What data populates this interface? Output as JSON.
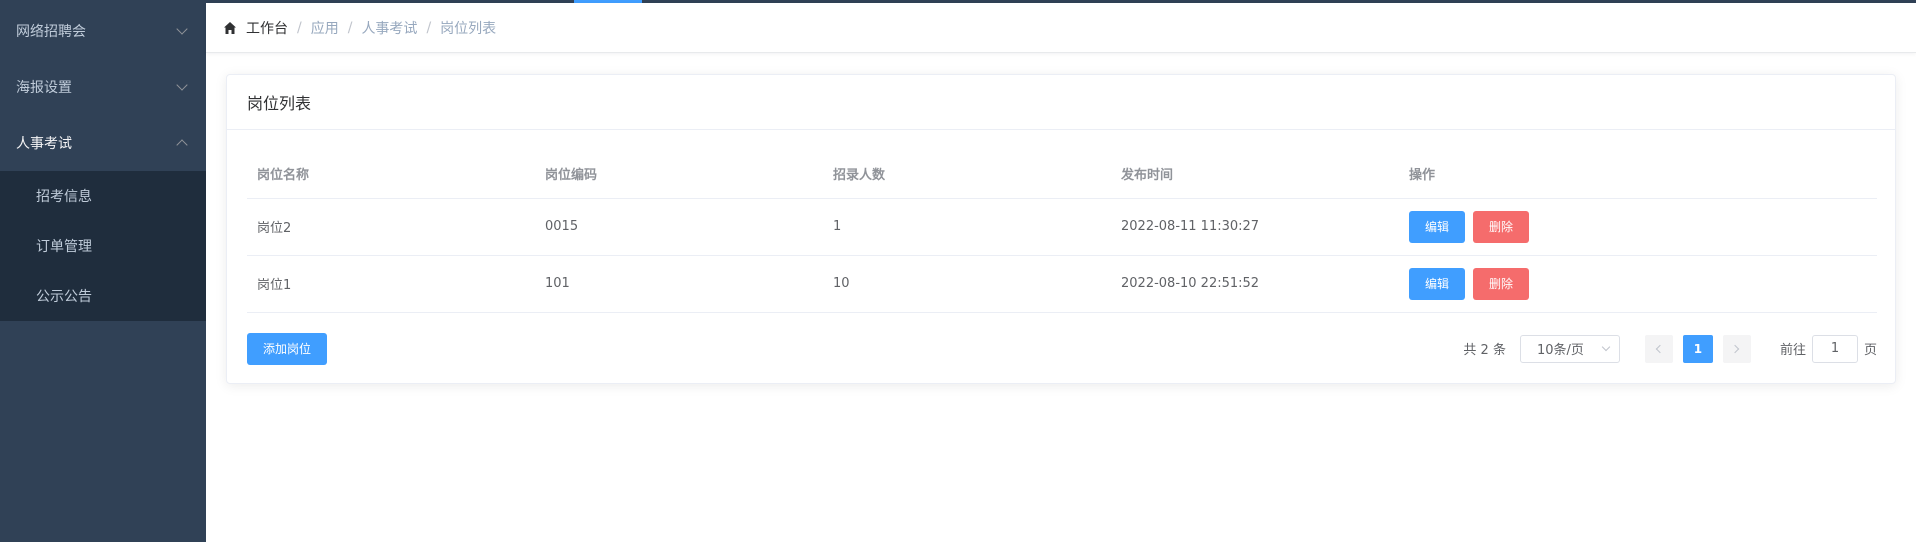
{
  "sidebar": {
    "items": [
      {
        "label": "网络招聘会"
      },
      {
        "label": "海报设置"
      },
      {
        "label": "人事考试"
      }
    ],
    "submenu": [
      {
        "label": "招考信息"
      },
      {
        "label": "订单管理"
      },
      {
        "label": "公示公告"
      }
    ]
  },
  "breadcrumb": {
    "items": [
      "工作台",
      "应用",
      "人事考试",
      "岗位列表"
    ],
    "separator": "/"
  },
  "card": {
    "title": "岗位列表"
  },
  "table": {
    "headers": [
      "岗位名称",
      "岗位编码",
      "招录人数",
      "发布时间",
      "操作"
    ],
    "rows": [
      {
        "name": "岗位2",
        "code": "0015",
        "count": "1",
        "time": "2022-08-11 11:30:27"
      },
      {
        "name": "岗位1",
        "code": "101",
        "count": "10",
        "time": "2022-08-10 22:51:52"
      }
    ],
    "edit_label": "编辑",
    "delete_label": "删除"
  },
  "actions": {
    "add_label": "添加岗位"
  },
  "pagination": {
    "total_text": "共 2 条",
    "page_size": "10条/页",
    "current_page": "1",
    "goto_prefix": "前往",
    "goto_value": "1",
    "goto_suffix": "页"
  },
  "colors": {
    "sidebar_bg": "#304156",
    "submenu_bg": "#1f2d3d",
    "primary": "#409eff",
    "danger": "#f56c6c"
  }
}
